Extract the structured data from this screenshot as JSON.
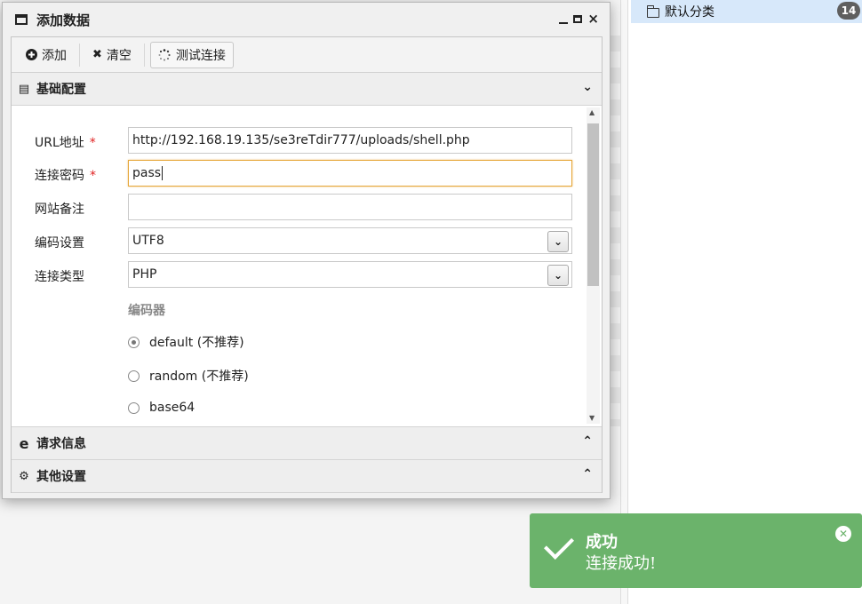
{
  "background": {
    "tree": {
      "item_label": "默认分类",
      "count": "14"
    }
  },
  "dialog": {
    "title": "添加数据",
    "controls": {
      "close_glyph": "×"
    },
    "toolbar": {
      "add_label": "添加",
      "clear_label": "清空",
      "test_label": "测试连接"
    },
    "sections": {
      "basic": "基础配置",
      "request": "请求信息",
      "other": "其他设置"
    },
    "form": {
      "url_label": "URL地址",
      "url_value": "http://192.168.19.135/se3reTdir777/uploads/shell.php",
      "password_label": "连接密码",
      "password_value": "pass",
      "note_label": "网站备注",
      "note_value": "",
      "encoding_label": "编码设置",
      "encoding_value": "UTF8",
      "type_label": "连接类型",
      "type_value": "PHP",
      "encoder_title": "编码器",
      "required_mark": "*",
      "encoders": [
        {
          "label": "default (不推荐)",
          "selected": true
        },
        {
          "label": "random (不推荐)",
          "selected": false
        },
        {
          "label": "base64",
          "selected": false
        }
      ]
    }
  },
  "toast": {
    "title": "成功",
    "message": "连接成功!",
    "color": "#6bb36b"
  }
}
